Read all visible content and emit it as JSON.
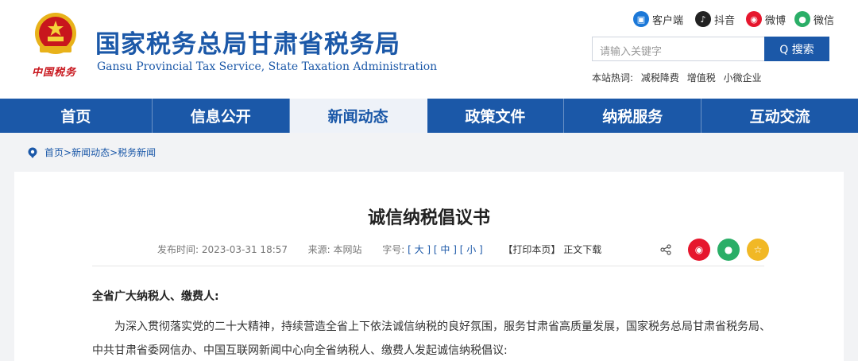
{
  "header": {
    "title_cn": "国家税务总局甘肃省税务局",
    "title_en": "Gansu Provincial Tax Service, State Taxation Administration",
    "emblem_sig": "中国税务",
    "social": [
      {
        "label": "客户端",
        "icon": "client-app-icon",
        "color": "#1b78d8"
      },
      {
        "label": "抖音",
        "icon": "douyin-icon",
        "color": "#222222"
      },
      {
        "label": "微博",
        "icon": "weibo-icon",
        "color": "#e6162d"
      },
      {
        "label": "微信",
        "icon": "wechat-icon",
        "color": "#2aae67"
      }
    ],
    "search": {
      "placeholder": "请输入关键字",
      "button": "Q 搜索"
    },
    "hot": {
      "label": "本站热词:",
      "terms": [
        "减税降费",
        "增值税",
        "小微企业"
      ]
    }
  },
  "nav": {
    "items": [
      "首页",
      "信息公开",
      "新闻动态",
      "政策文件",
      "纳税服务",
      "互动交流"
    ],
    "active": "新闻动态"
  },
  "breadcrumb": [
    "首页>",
    "新闻动态>",
    "税务新闻"
  ],
  "article": {
    "title": "诚信纳税倡议书",
    "meta": {
      "date_label": "发布时间:",
      "date": "2023-03-31 18:57",
      "source_label": "来源:",
      "source": "本网站",
      "font_label": "字号:",
      "sizes": [
        "[ 大 ]",
        "[ 中 ]",
        "[ 小 ]"
      ],
      "print": "【打印本页】",
      "download": "正文下载"
    },
    "salutation": "全省广大纳税人、缴费人:",
    "paragraph": "为深入贯彻落实党的二十大精神，持续营造全省上下依法诚信纳税的良好氛围，服务甘肃省高质量发展，国家税务总局甘肃省税务局、中共甘肃省委网信办、中国互联网新闻中心向全省纳税人、缴费人发起诚信纳税倡议:"
  },
  "colors": {
    "brand": "#1b58a8",
    "red": "#c8161d"
  }
}
